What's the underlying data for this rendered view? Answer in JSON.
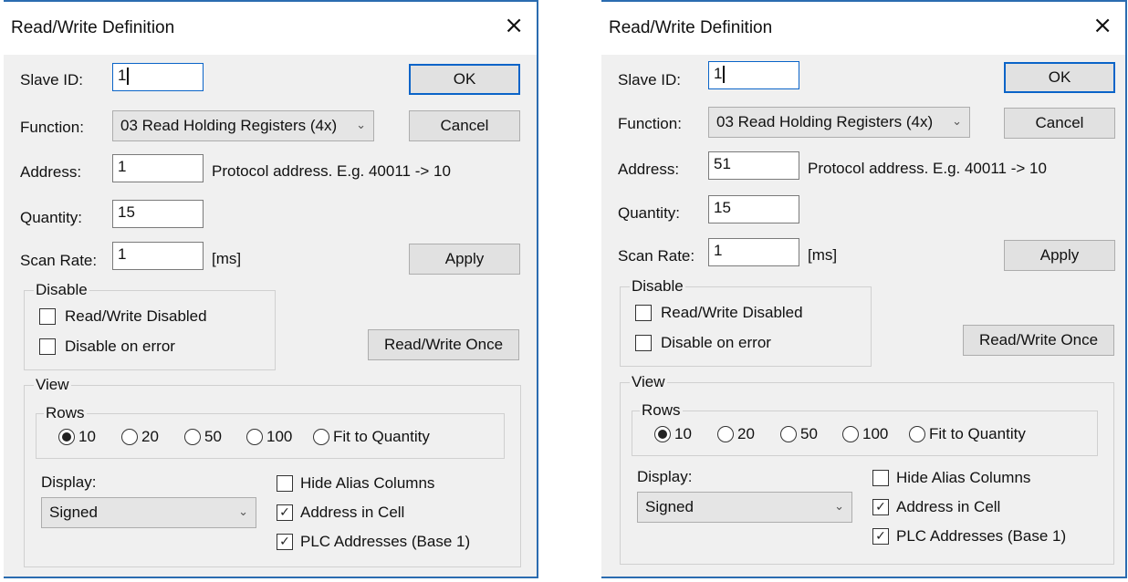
{
  "dialogs": [
    {
      "title": "Read/Write Definition",
      "close_icon": "×",
      "labels": {
        "slave_id": "Slave ID:",
        "function": "Function:",
        "address": "Address:",
        "quantity": "Quantity:",
        "scan_rate": "Scan Rate:",
        "scan_unit": "[ms]",
        "address_hint": "Protocol address. E.g. 40011 -> 10"
      },
      "values": {
        "slave_id": "1",
        "function": "03 Read Holding Registers (4x)",
        "address": "1",
        "quantity": "15",
        "scan_rate": "1"
      },
      "buttons": {
        "ok": "OK",
        "cancel": "Cancel",
        "apply": "Apply",
        "rw_once": "Read/Write Once"
      },
      "disable": {
        "title": "Disable",
        "rw_disabled": {
          "label": "Read/Write Disabled",
          "checked": false
        },
        "on_error": {
          "label": "Disable on error",
          "checked": false
        }
      },
      "view": {
        "title": "View",
        "rows_title": "Rows",
        "rows_options": [
          "10",
          "20",
          "50",
          "100",
          "Fit to Quantity"
        ],
        "rows_selected": "10",
        "display_label": "Display:",
        "display_value": "Signed",
        "hide_alias": {
          "label": "Hide Alias Columns",
          "checked": false
        },
        "address_in_cell": {
          "label": "Address in Cell",
          "checked": true
        },
        "plc_addresses": {
          "label": "PLC Addresses (Base 1)",
          "checked": true
        }
      }
    },
    {
      "title": "Read/Write Definition",
      "close_icon": "×",
      "labels": {
        "slave_id": "Slave ID:",
        "function": "Function:",
        "address": "Address:",
        "quantity": "Quantity:",
        "scan_rate": "Scan Rate:",
        "scan_unit": "[ms]",
        "address_hint": "Protocol address. E.g. 40011 -> 10"
      },
      "values": {
        "slave_id": "1",
        "function": "03 Read Holding Registers (4x)",
        "address": "51",
        "quantity": "15",
        "scan_rate": "1"
      },
      "buttons": {
        "ok": "OK",
        "cancel": "Cancel",
        "apply": "Apply",
        "rw_once": "Read/Write Once"
      },
      "disable": {
        "title": "Disable",
        "rw_disabled": {
          "label": "Read/Write Disabled",
          "checked": false
        },
        "on_error": {
          "label": "Disable on error",
          "checked": false
        }
      },
      "view": {
        "title": "View",
        "rows_title": "Rows",
        "rows_options": [
          "10",
          "20",
          "50",
          "100",
          "Fit to Quantity"
        ],
        "rows_selected": "10",
        "display_label": "Display:",
        "display_value": "Signed",
        "hide_alias": {
          "label": "Hide Alias Columns",
          "checked": false
        },
        "address_in_cell": {
          "label": "Address in Cell",
          "checked": true
        },
        "plc_addresses": {
          "label": "PLC Addresses (Base 1)",
          "checked": true
        }
      }
    }
  ],
  "icons": {
    "close": "close-icon",
    "chevron": "chevron-down-icon",
    "check": "checkmark-icon"
  }
}
